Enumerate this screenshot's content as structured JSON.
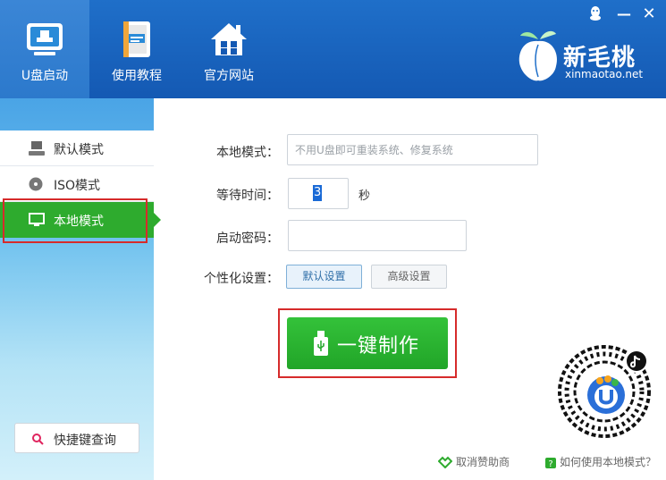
{
  "header": {
    "tabs": [
      {
        "label": "U盘启动",
        "icon": "usb-boot-icon"
      },
      {
        "label": "使用教程",
        "icon": "book-icon"
      },
      {
        "label": "官方网站",
        "icon": "house-icon"
      }
    ],
    "brand": {
      "name": "新毛桃",
      "url": "xinmaotao.net"
    },
    "window_controls": {
      "qq": "qq-icon",
      "minimize": "—",
      "close": "✕"
    }
  },
  "sidebar": {
    "items": [
      {
        "label": "默认模式",
        "icon": "computer-icon"
      },
      {
        "label": "ISO模式",
        "icon": "disc-icon"
      },
      {
        "label": "本地模式",
        "icon": "monitor-icon"
      }
    ],
    "hotkey_button": "快捷键查询"
  },
  "form": {
    "local_mode_label": "本地模式：",
    "local_mode_placeholder": "不用U盘即可重装系统、修复系统",
    "wait_time_label": "等待时间：",
    "wait_time_value": "3",
    "wait_time_unit": "秒",
    "boot_password_label": "启动密码：",
    "boot_password_value": "",
    "custom_settings_label": "个性化设置：",
    "default_settings_button": "默认设置",
    "advanced_settings_button": "高级设置"
  },
  "make_button": "一键制作",
  "footer": {
    "cancel_sponsor": "取消赞助商",
    "how_to_use": "如何使用本地模式？"
  },
  "colors": {
    "header_blue": "#1f6fc9",
    "active_green": "#2eab2e",
    "highlight_red": "#d62b2b"
  }
}
